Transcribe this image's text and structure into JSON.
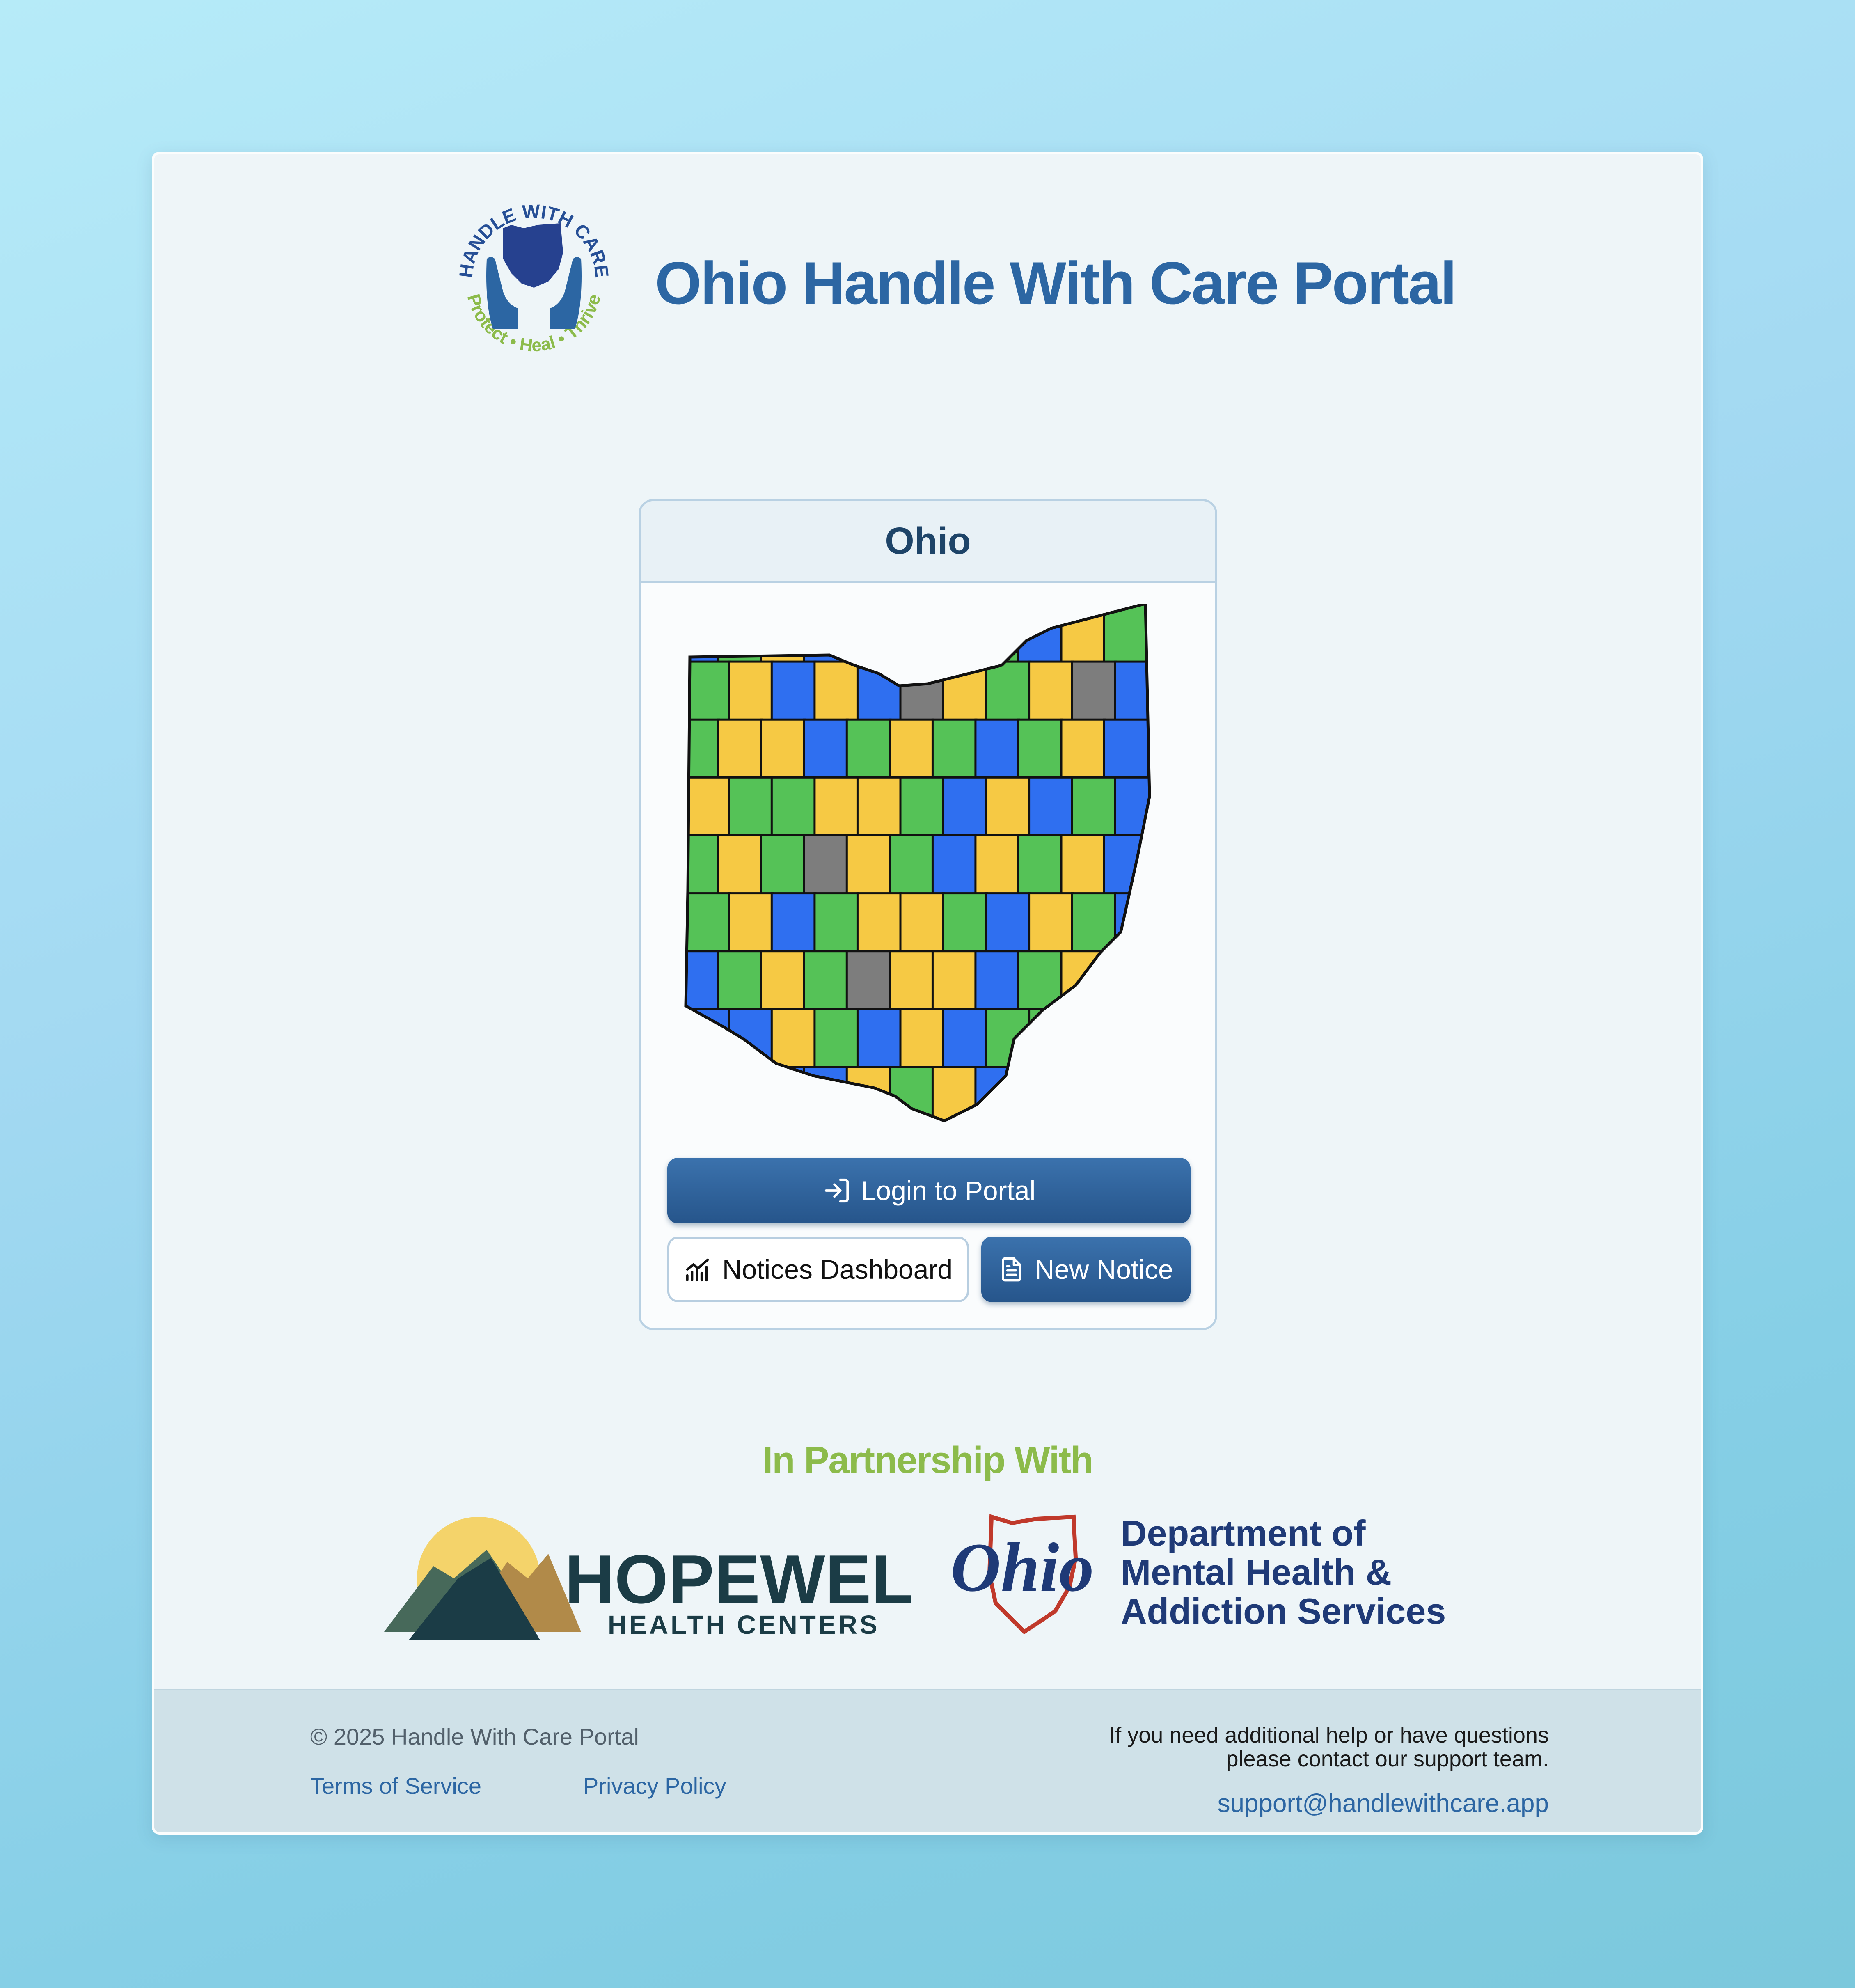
{
  "app": {
    "title": "Ohio Handle With Care Portal",
    "logo_text_top": "HANDLE WITH CARE",
    "logo_text_bottom": "Protect • Heal • Thrive"
  },
  "panel": {
    "state_name": "Ohio",
    "map_icon": "ohio-county-map"
  },
  "buttons": {
    "login": {
      "label": "Login to Portal",
      "icon": "login-icon"
    },
    "dashboard": {
      "label": "Notices Dashboard",
      "icon": "bar-chart-icon"
    },
    "new_notice": {
      "label": "New Notice",
      "icon": "document-icon"
    }
  },
  "partners": {
    "heading": "In Partnership With",
    "hopewell": {
      "name": "HOPEWELL",
      "subtitle": "HEALTH CENTERS"
    },
    "ohmhas": {
      "mark": "Ohio",
      "line1": "Department of",
      "line2": "Mental Health &",
      "line3": "Addiction Services"
    }
  },
  "footer": {
    "copyright": "© 2025 Handle With Care Portal",
    "terms": "Terms of Service",
    "privacy": "Privacy Policy",
    "help_line1": "If you need additional help or have questions",
    "help_line2": "please contact our support team.",
    "support_email": "support@handlewithcare.app"
  },
  "colors": {
    "brand_blue": "#2c66a3",
    "brand_green": "#8cbb4b",
    "map_blue": "#2f6ff0",
    "map_green": "#55c257",
    "map_yellow": "#f6c944",
    "map_gray": "#7d7d7d"
  }
}
